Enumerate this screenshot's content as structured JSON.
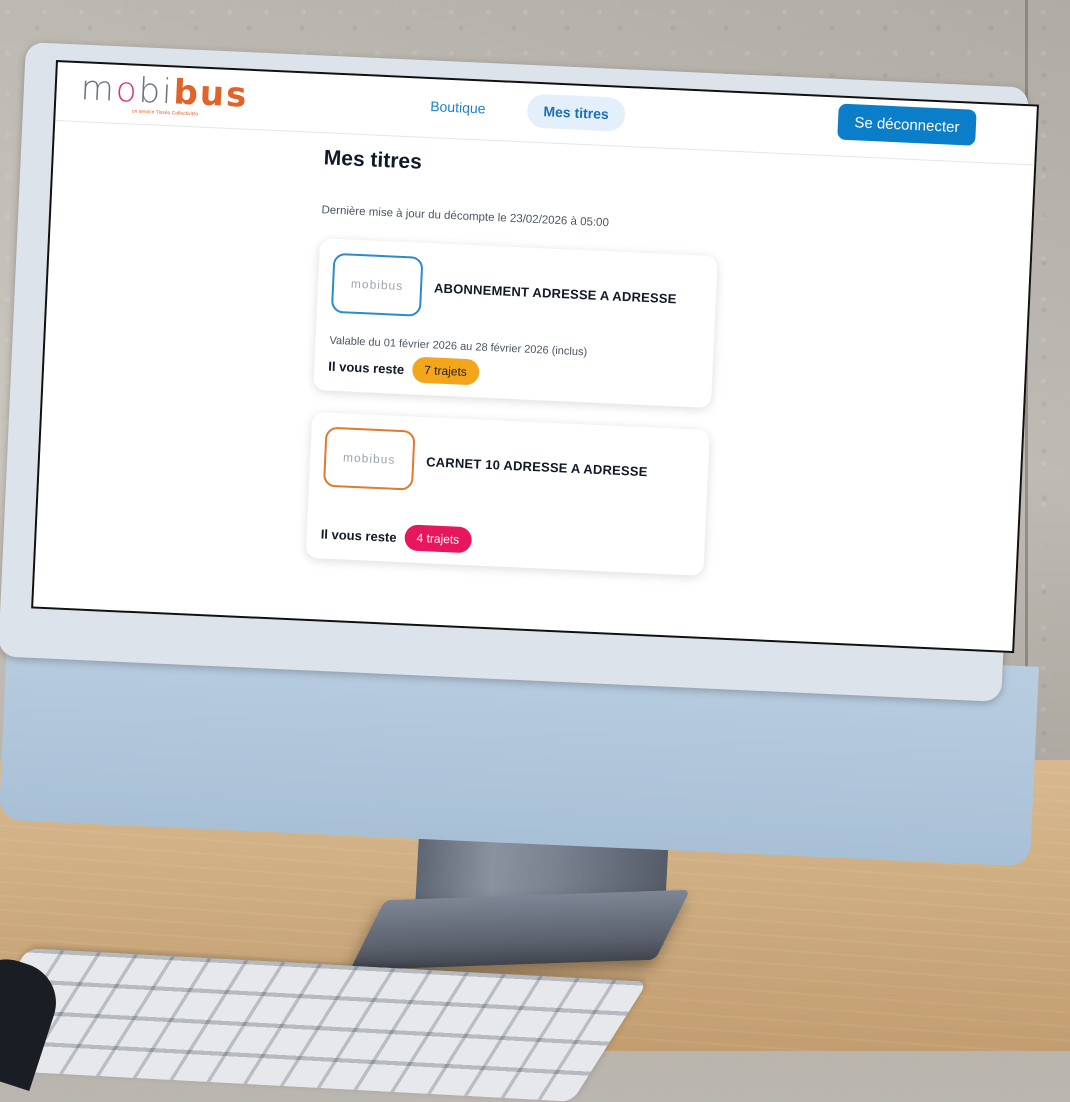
{
  "header": {
    "logo_text_pre": "m",
    "logo_text_o": "o",
    "logo_text_mid": "bi",
    "logo_text_bus": "bus",
    "logo_tagline": "un service Tisséo Collectivités",
    "nav": [
      {
        "label": "Boutique",
        "active": false
      },
      {
        "label": "Mes titres",
        "active": true
      }
    ],
    "logout_label": "Se déconnecter"
  },
  "main": {
    "title": "Mes titres",
    "update_text": "Dernière mise à jour du décompte le 23/02/2026 à 05:00",
    "remaining_label": "Il vous reste",
    "tickets": [
      {
        "logo_text": "mobibus",
        "name": "ABONNEMENT ADRESSE A ADRESSE",
        "validity": "Valable du 01 février 2026 au 28 février 2026 (inclus)",
        "remaining": "7 trajets",
        "pill_color": "#f3a51c",
        "frame_color": "#2a8ccc"
      },
      {
        "logo_text": "mobibus",
        "name": "CARNET 10 ADRESSE A ADRESSE",
        "remaining": "4 trajets",
        "pill_color": "#e8175d",
        "frame_color": "#e07a2e"
      }
    ]
  },
  "colors": {
    "primary": "#0a7ec9",
    "brand_orange": "#e0632a",
    "brand_pink": "#e0336e"
  }
}
